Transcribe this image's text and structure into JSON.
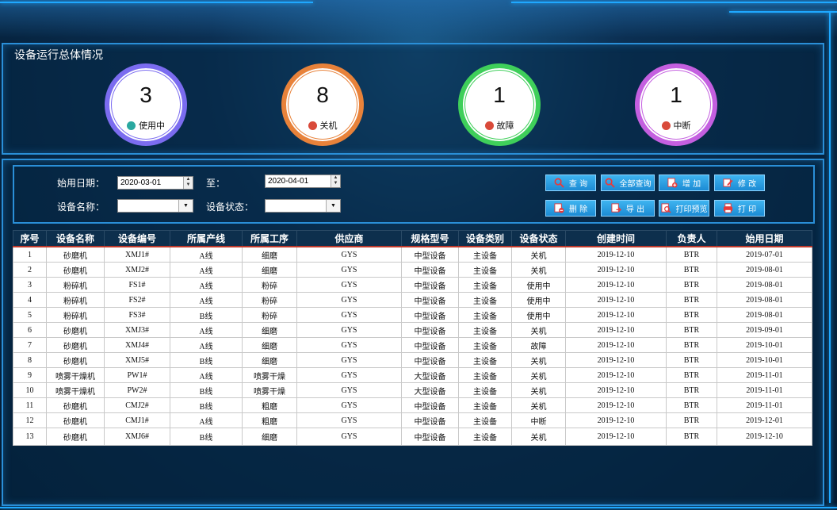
{
  "summary": {
    "title": "设备运行总体情况",
    "stats": [
      {
        "count": "3",
        "label": "使用中",
        "ring_color": "#7b6cf0",
        "icon": "gear-icon",
        "icon_color": "#2aa8a0"
      },
      {
        "count": "8",
        "label": "关机",
        "ring_color": "#e8823a",
        "icon": "power-icon",
        "icon_color": "#d94a3a"
      },
      {
        "count": "1",
        "label": "故障",
        "ring_color": "#3fcf5a",
        "icon": "blocked-icon",
        "icon_color": "#d94a3a"
      },
      {
        "count": "1",
        "label": "中断",
        "ring_color": "#c45fe0",
        "icon": "warning-icon",
        "icon_color": "#d94a3a"
      }
    ]
  },
  "filters": {
    "start_date_label": "始用日期：",
    "start_date_value": "2020-03-01",
    "to_label": "至：",
    "end_date_value": "2020-04-01",
    "name_label": "设备名称：",
    "name_value": "",
    "status_label": "设备状态：",
    "status_value": ""
  },
  "buttons": {
    "query": "查 询",
    "query_all": "全部查询",
    "add": "增 加",
    "edit": "修 改",
    "delete": "删 除",
    "export": "导 出",
    "print_preview": "打印预览",
    "print": "打 印"
  },
  "table": {
    "headers": [
      "序号",
      "设备名称",
      "设备编号",
      "所属产线",
      "所属工序",
      "供应商",
      "规格型号",
      "设备类别",
      "设备状态",
      "创建时间",
      "负责人",
      "始用日期"
    ],
    "rows": [
      [
        "1",
        "砂磨机",
        "XMJ1#",
        "A线",
        "细磨",
        "GYS",
        "中型设备",
        "主设备",
        "关机",
        "2019-12-10",
        "BTR",
        "2019-07-01"
      ],
      [
        "2",
        "砂磨机",
        "XMJ2#",
        "A线",
        "细磨",
        "GYS",
        "中型设备",
        "主设备",
        "关机",
        "2019-12-10",
        "BTR",
        "2019-08-01"
      ],
      [
        "3",
        "粉碎机",
        "FS1#",
        "A线",
        "粉碎",
        "GYS",
        "中型设备",
        "主设备",
        "使用中",
        "2019-12-10",
        "BTR",
        "2019-08-01"
      ],
      [
        "4",
        "粉碎机",
        "FS2#",
        "A线",
        "粉碎",
        "GYS",
        "中型设备",
        "主设备",
        "使用中",
        "2019-12-10",
        "BTR",
        "2019-08-01"
      ],
      [
        "5",
        "粉碎机",
        "FS3#",
        "B线",
        "粉碎",
        "GYS",
        "中型设备",
        "主设备",
        "使用中",
        "2019-12-10",
        "BTR",
        "2019-08-01"
      ],
      [
        "6",
        "砂磨机",
        "XMJ3#",
        "A线",
        "细磨",
        "GYS",
        "中型设备",
        "主设备",
        "关机",
        "2019-12-10",
        "BTR",
        "2019-09-01"
      ],
      [
        "7",
        "砂磨机",
        "XMJ4#",
        "A线",
        "细磨",
        "GYS",
        "中型设备",
        "主设备",
        "故障",
        "2019-12-10",
        "BTR",
        "2019-10-01"
      ],
      [
        "8",
        "砂磨机",
        "XMJ5#",
        "B线",
        "细磨",
        "GYS",
        "中型设备",
        "主设备",
        "关机",
        "2019-12-10",
        "BTR",
        "2019-10-01"
      ],
      [
        "9",
        "喷雾干燥机",
        "PW1#",
        "A线",
        "喷雾干燥",
        "GYS",
        "大型设备",
        "主设备",
        "关机",
        "2019-12-10",
        "BTR",
        "2019-11-01"
      ],
      [
        "10",
        "喷雾干燥机",
        "PW2#",
        "B线",
        "喷雾干燥",
        "GYS",
        "大型设备",
        "主设备",
        "关机",
        "2019-12-10",
        "BTR",
        "2019-11-01"
      ],
      [
        "11",
        "砂磨机",
        "CMJ2#",
        "B线",
        "粗磨",
        "GYS",
        "中型设备",
        "主设备",
        "关机",
        "2019-12-10",
        "BTR",
        "2019-11-01"
      ],
      [
        "12",
        "砂磨机",
        "CMJ1#",
        "A线",
        "粗磨",
        "GYS",
        "中型设备",
        "主设备",
        "中断",
        "2019-12-10",
        "BTR",
        "2019-12-01"
      ],
      [
        "13",
        "砂磨机",
        "XMJ6#",
        "B线",
        "细磨",
        "GYS",
        "中型设备",
        "主设备",
        "关机",
        "2019-12-10",
        "BTR",
        "2019-12-10"
      ]
    ]
  }
}
